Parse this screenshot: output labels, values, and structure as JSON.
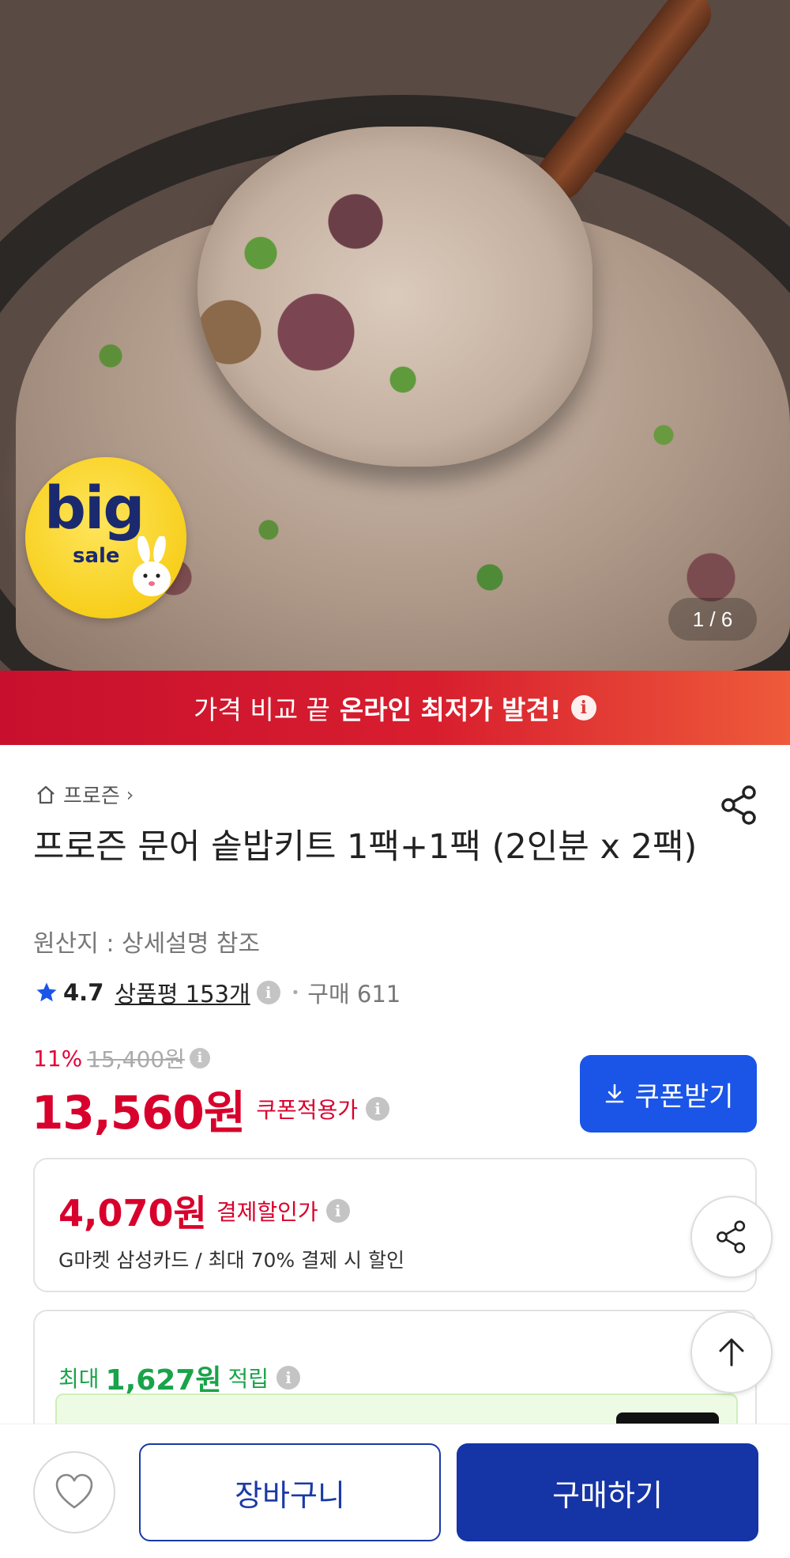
{
  "hero": {
    "badge_big": "big",
    "badge_sale": "sale",
    "page_counter": "1 / 6"
  },
  "promo": {
    "prefix": "가격 비교 끝",
    "highlight": "온라인 최저가 발견!",
    "info_glyph": "i"
  },
  "breadcrumb": {
    "category": "프로즌",
    "chevron": "›"
  },
  "product": {
    "title": "프로즌 문어 솥밥키트 1팩+1팩 (2인분 x 2팩)",
    "origin": "원산지 : 상세설명 참조",
    "rating": "4.7",
    "review_label": "상품평 153개",
    "purchase_label": "구매 611",
    "separator": "•"
  },
  "pricing": {
    "discount_pct": "11%",
    "original_price": "15,400원",
    "price": "13,560원",
    "coupon_applied_label": "쿠폰적용가",
    "coupon_button": "쿠폰받기"
  },
  "card_discount": {
    "amount": "4,070원",
    "label": "결제할인가",
    "description": "G마켓 삼성카드 / 최대 70% 결제 시 할인"
  },
  "points": {
    "prefix": "최대",
    "amount": "1,627원",
    "suffix": "적립"
  },
  "bottom_bar": {
    "cart_label": "장바구니",
    "buy_label": "구매하기"
  },
  "colors": {
    "price_red": "#d8002c",
    "coupon_blue": "#1a55e8",
    "buy_navy": "#1534a6",
    "points_green": "#1aa34a",
    "promo_red": "#c8102e"
  },
  "icons": [
    "home-icon",
    "share-icon",
    "star-icon",
    "info-icon",
    "download-icon",
    "arrow-up-icon",
    "heart-icon"
  ]
}
